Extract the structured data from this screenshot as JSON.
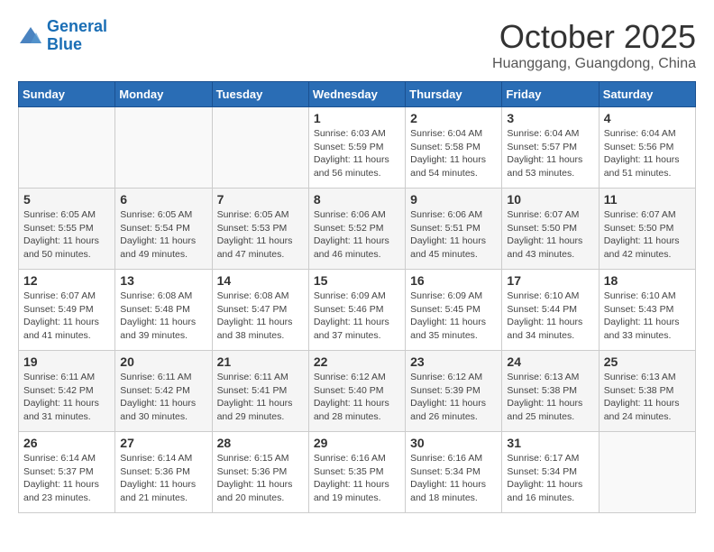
{
  "logo": {
    "line1": "General",
    "line2": "Blue"
  },
  "title": "October 2025",
  "location": "Huanggang, Guangdong, China",
  "headers": [
    "Sunday",
    "Monday",
    "Tuesday",
    "Wednesday",
    "Thursday",
    "Friday",
    "Saturday"
  ],
  "weeks": [
    [
      {
        "day": "",
        "info": ""
      },
      {
        "day": "",
        "info": ""
      },
      {
        "day": "",
        "info": ""
      },
      {
        "day": "1",
        "info": "Sunrise: 6:03 AM\nSunset: 5:59 PM\nDaylight: 11 hours\nand 56 minutes."
      },
      {
        "day": "2",
        "info": "Sunrise: 6:04 AM\nSunset: 5:58 PM\nDaylight: 11 hours\nand 54 minutes."
      },
      {
        "day": "3",
        "info": "Sunrise: 6:04 AM\nSunset: 5:57 PM\nDaylight: 11 hours\nand 53 minutes."
      },
      {
        "day": "4",
        "info": "Sunrise: 6:04 AM\nSunset: 5:56 PM\nDaylight: 11 hours\nand 51 minutes."
      }
    ],
    [
      {
        "day": "5",
        "info": "Sunrise: 6:05 AM\nSunset: 5:55 PM\nDaylight: 11 hours\nand 50 minutes."
      },
      {
        "day": "6",
        "info": "Sunrise: 6:05 AM\nSunset: 5:54 PM\nDaylight: 11 hours\nand 49 minutes."
      },
      {
        "day": "7",
        "info": "Sunrise: 6:05 AM\nSunset: 5:53 PM\nDaylight: 11 hours\nand 47 minutes."
      },
      {
        "day": "8",
        "info": "Sunrise: 6:06 AM\nSunset: 5:52 PM\nDaylight: 11 hours\nand 46 minutes."
      },
      {
        "day": "9",
        "info": "Sunrise: 6:06 AM\nSunset: 5:51 PM\nDaylight: 11 hours\nand 45 minutes."
      },
      {
        "day": "10",
        "info": "Sunrise: 6:07 AM\nSunset: 5:50 PM\nDaylight: 11 hours\nand 43 minutes."
      },
      {
        "day": "11",
        "info": "Sunrise: 6:07 AM\nSunset: 5:50 PM\nDaylight: 11 hours\nand 42 minutes."
      }
    ],
    [
      {
        "day": "12",
        "info": "Sunrise: 6:07 AM\nSunset: 5:49 PM\nDaylight: 11 hours\nand 41 minutes."
      },
      {
        "day": "13",
        "info": "Sunrise: 6:08 AM\nSunset: 5:48 PM\nDaylight: 11 hours\nand 39 minutes."
      },
      {
        "day": "14",
        "info": "Sunrise: 6:08 AM\nSunset: 5:47 PM\nDaylight: 11 hours\nand 38 minutes."
      },
      {
        "day": "15",
        "info": "Sunrise: 6:09 AM\nSunset: 5:46 PM\nDaylight: 11 hours\nand 37 minutes."
      },
      {
        "day": "16",
        "info": "Sunrise: 6:09 AM\nSunset: 5:45 PM\nDaylight: 11 hours\nand 35 minutes."
      },
      {
        "day": "17",
        "info": "Sunrise: 6:10 AM\nSunset: 5:44 PM\nDaylight: 11 hours\nand 34 minutes."
      },
      {
        "day": "18",
        "info": "Sunrise: 6:10 AM\nSunset: 5:43 PM\nDaylight: 11 hours\nand 33 minutes."
      }
    ],
    [
      {
        "day": "19",
        "info": "Sunrise: 6:11 AM\nSunset: 5:42 PM\nDaylight: 11 hours\nand 31 minutes."
      },
      {
        "day": "20",
        "info": "Sunrise: 6:11 AM\nSunset: 5:42 PM\nDaylight: 11 hours\nand 30 minutes."
      },
      {
        "day": "21",
        "info": "Sunrise: 6:11 AM\nSunset: 5:41 PM\nDaylight: 11 hours\nand 29 minutes."
      },
      {
        "day": "22",
        "info": "Sunrise: 6:12 AM\nSunset: 5:40 PM\nDaylight: 11 hours\nand 28 minutes."
      },
      {
        "day": "23",
        "info": "Sunrise: 6:12 AM\nSunset: 5:39 PM\nDaylight: 11 hours\nand 26 minutes."
      },
      {
        "day": "24",
        "info": "Sunrise: 6:13 AM\nSunset: 5:38 PM\nDaylight: 11 hours\nand 25 minutes."
      },
      {
        "day": "25",
        "info": "Sunrise: 6:13 AM\nSunset: 5:38 PM\nDaylight: 11 hours\nand 24 minutes."
      }
    ],
    [
      {
        "day": "26",
        "info": "Sunrise: 6:14 AM\nSunset: 5:37 PM\nDaylight: 11 hours\nand 23 minutes."
      },
      {
        "day": "27",
        "info": "Sunrise: 6:14 AM\nSunset: 5:36 PM\nDaylight: 11 hours\nand 21 minutes."
      },
      {
        "day": "28",
        "info": "Sunrise: 6:15 AM\nSunset: 5:36 PM\nDaylight: 11 hours\nand 20 minutes."
      },
      {
        "day": "29",
        "info": "Sunrise: 6:16 AM\nSunset: 5:35 PM\nDaylight: 11 hours\nand 19 minutes."
      },
      {
        "day": "30",
        "info": "Sunrise: 6:16 AM\nSunset: 5:34 PM\nDaylight: 11 hours\nand 18 minutes."
      },
      {
        "day": "31",
        "info": "Sunrise: 6:17 AM\nSunset: 5:34 PM\nDaylight: 11 hours\nand 16 minutes."
      },
      {
        "day": "",
        "info": ""
      }
    ]
  ]
}
